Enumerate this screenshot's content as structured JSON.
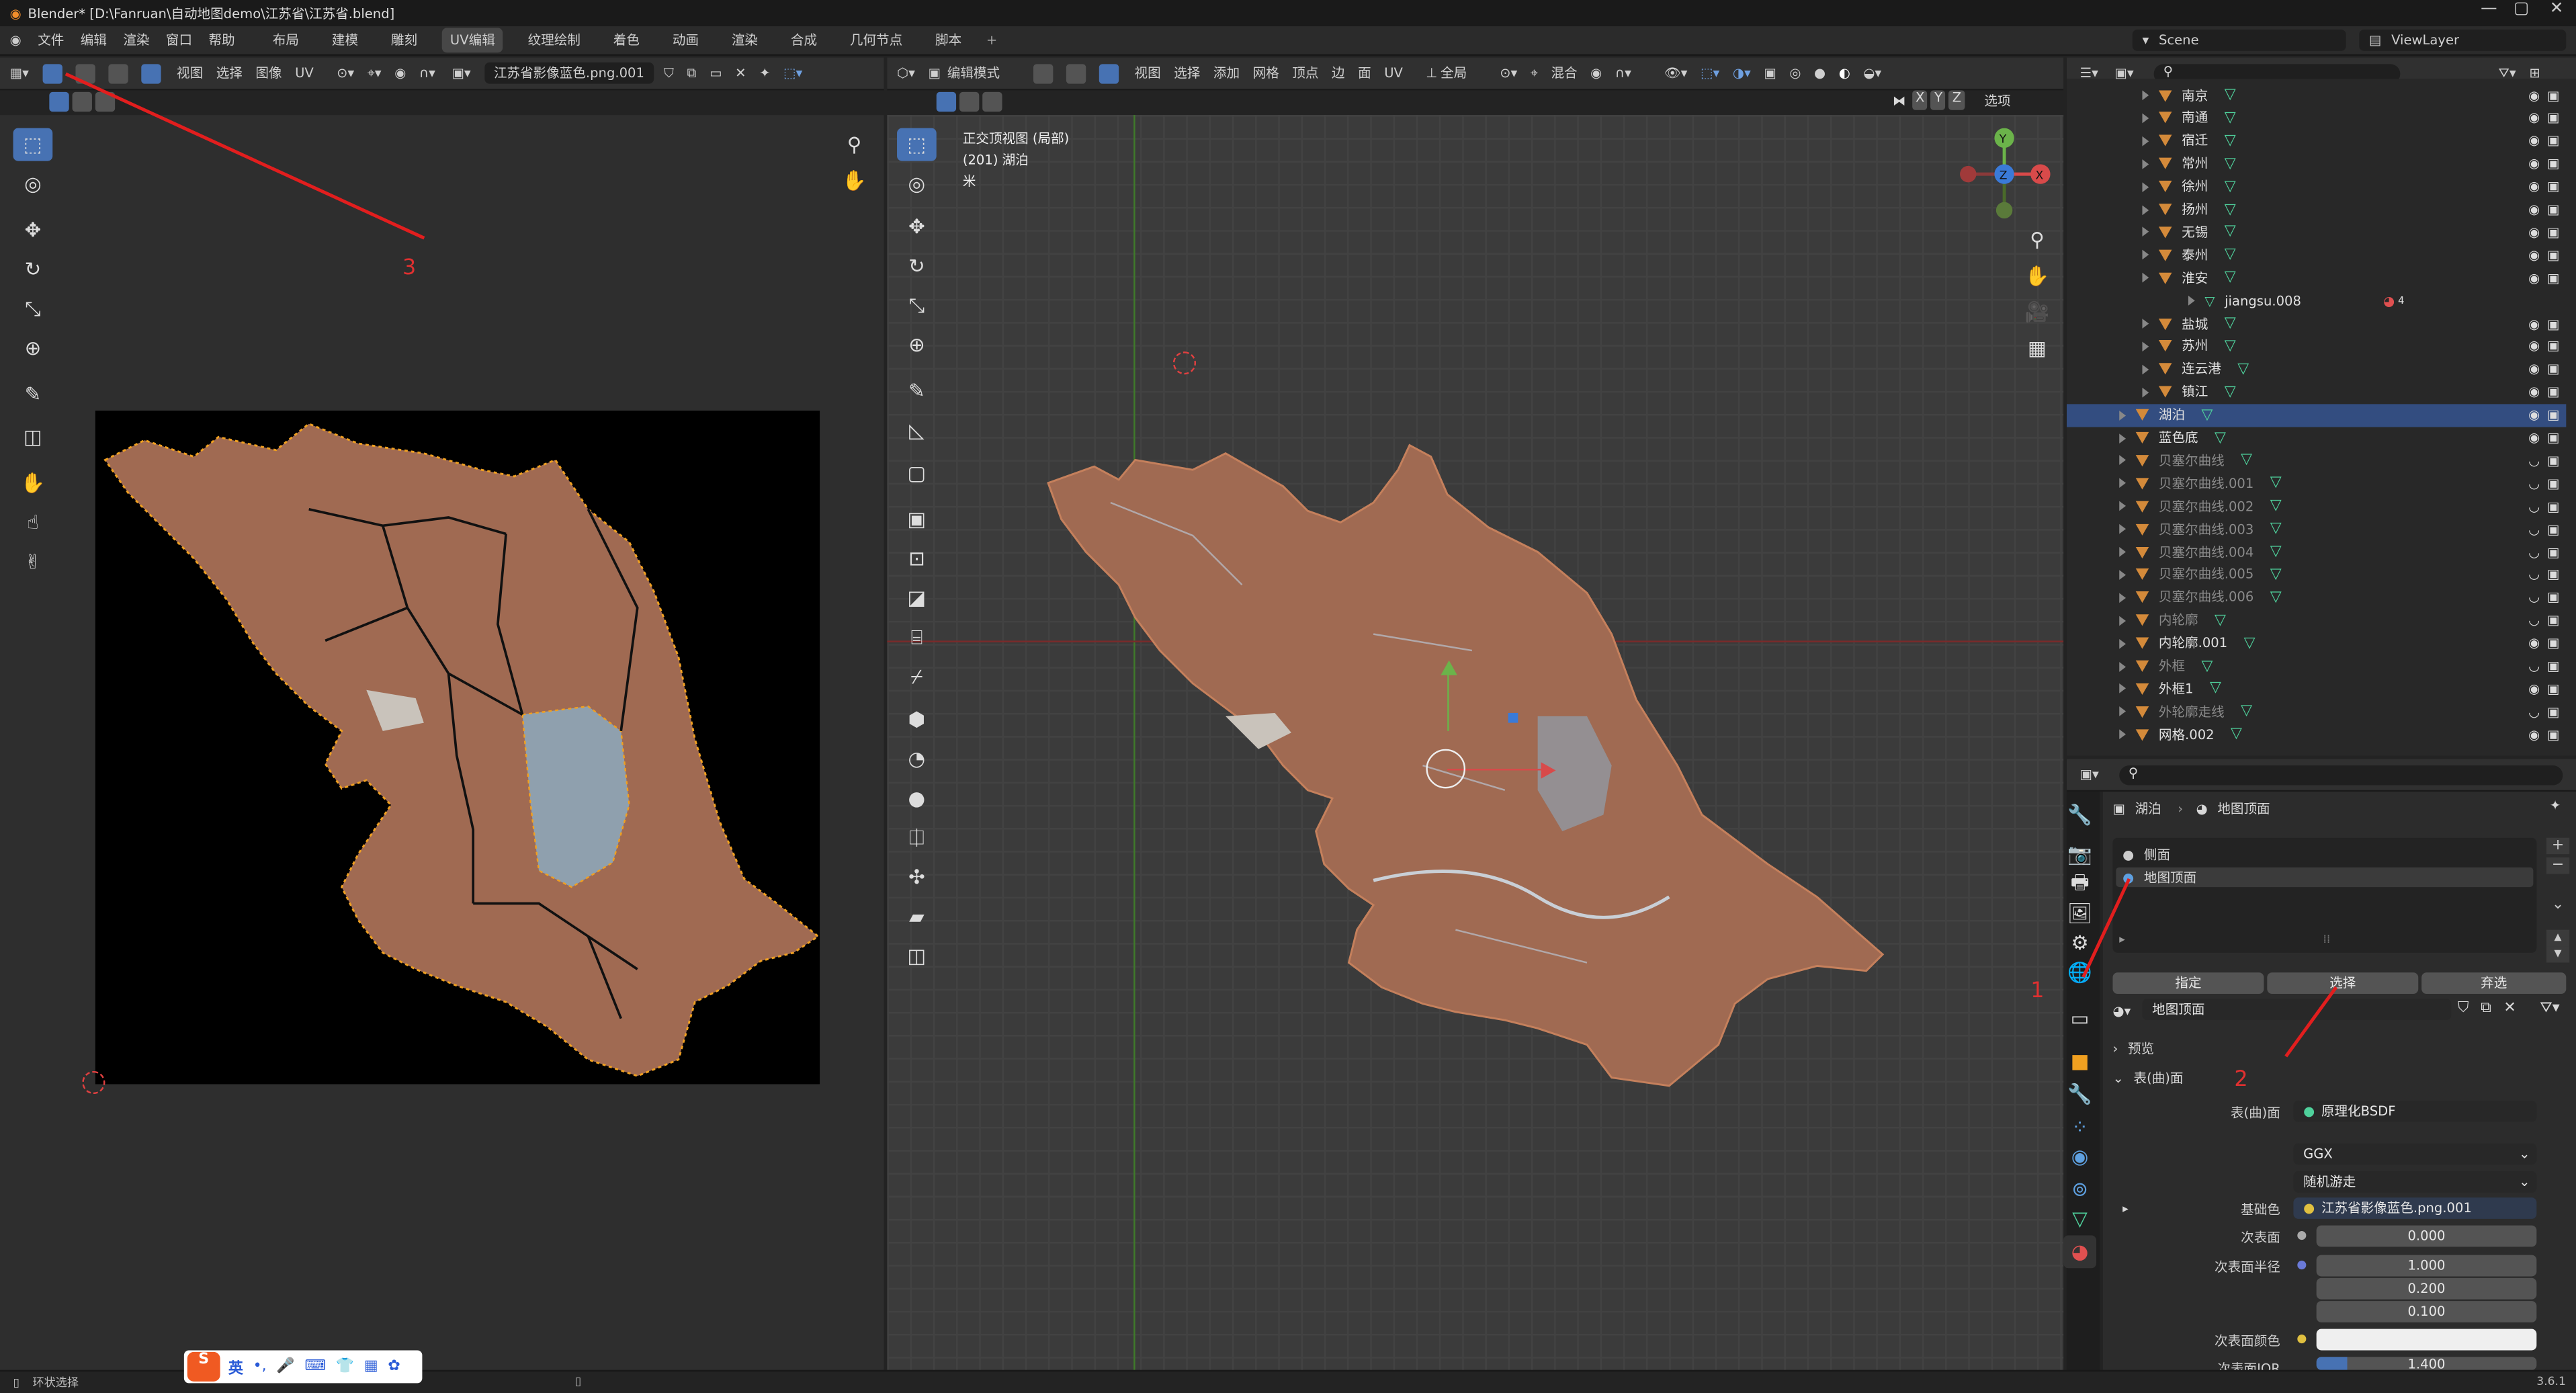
{
  "window": {
    "title": "Blender* [D:\\Fanruan\\自动地图demo\\江苏省\\江苏省.blend]"
  },
  "top_menu": {
    "items": [
      "文件",
      "编辑",
      "渲染",
      "窗口",
      "帮助"
    ],
    "workspaces": [
      "布局",
      "建模",
      "雕刻",
      "UV编辑",
      "纹理绘制",
      "着色",
      "动画",
      "渲染",
      "合成",
      "几何节点",
      "脚本"
    ],
    "active_workspace": "UV编辑",
    "scene": "Scene",
    "view_layer": "ViewLayer"
  },
  "uv_editor": {
    "menus": [
      "视图",
      "选择",
      "图像",
      "UV"
    ],
    "image_name": "江苏省影像蓝色.png.001"
  },
  "viewport": {
    "mode": "编辑模式",
    "menus": [
      "视图",
      "选择",
      "添加",
      "网格",
      "顶点",
      "边",
      "面",
      "UV"
    ],
    "transform_orientation": "全局",
    "blend": "混合",
    "axes": [
      "X",
      "Y",
      "Z"
    ],
    "options": "选项",
    "overlay_title": "正交顶视图 (局部)",
    "overlay_object": "(201) 湖泊",
    "overlay_unit": "米"
  },
  "outliner": {
    "rows": [
      {
        "label": "南京",
        "state": "normal"
      },
      {
        "label": "南通",
        "state": "normal"
      },
      {
        "label": "宿迁",
        "state": "normal"
      },
      {
        "label": "常州",
        "state": "normal"
      },
      {
        "label": "徐州",
        "state": "normal"
      },
      {
        "label": "扬州",
        "state": "normal"
      },
      {
        "label": "无锡",
        "state": "normal"
      },
      {
        "label": "泰州",
        "state": "normal"
      },
      {
        "label": "淮安",
        "state": "normal"
      },
      {
        "label": "jiangsu.008",
        "state": "child"
      },
      {
        "label": "盐城",
        "state": "normal"
      },
      {
        "label": "苏州",
        "state": "normal"
      },
      {
        "label": "连云港",
        "state": "normal"
      },
      {
        "label": "镇江",
        "state": "normal"
      },
      {
        "label": "湖泊",
        "state": "selected"
      },
      {
        "label": "蓝色底",
        "state": "normal"
      },
      {
        "label": "贝塞尔曲线",
        "state": "dim"
      },
      {
        "label": "贝塞尔曲线.001",
        "state": "dim"
      },
      {
        "label": "贝塞尔曲线.002",
        "state": "dim"
      },
      {
        "label": "贝塞尔曲线.003",
        "state": "dim"
      },
      {
        "label": "贝塞尔曲线.004",
        "state": "dim"
      },
      {
        "label": "贝塞尔曲线.005",
        "state": "dim"
      },
      {
        "label": "贝塞尔曲线.006",
        "state": "dim"
      },
      {
        "label": "内轮廓",
        "state": "dim"
      },
      {
        "label": "内轮廓.001",
        "state": "normal"
      },
      {
        "label": "外框",
        "state": "dim"
      },
      {
        "label": "外框1",
        "state": "normal"
      },
      {
        "label": "外轮廓走线",
        "state": "dim"
      },
      {
        "label": "网格.002",
        "state": "normal"
      }
    ],
    "child_badge": "4"
  },
  "properties": {
    "breadcrumb_object": "湖泊",
    "breadcrumb_material": "地图顶面",
    "material_slots": [
      "侧面",
      "地图顶面"
    ],
    "actions": [
      "指定",
      "选择",
      "弃选"
    ],
    "material_name": "地图顶面",
    "panels": {
      "preview": "预览",
      "surface": "表(曲)面"
    },
    "surface_label": "表(曲)面",
    "surface_value": "原理化BSDF",
    "distribution": "GGX",
    "subsurface_method": "随机游走",
    "base_color_label": "基础色",
    "base_color_value": "江苏省影像蓝色.png.001",
    "subsurface_label": "次表面",
    "subsurface_value": "0.000",
    "subsurface_radius_label": "次表面半径",
    "subsurface_radius": [
      "1.000",
      "0.200",
      "0.100"
    ],
    "subsurface_color_label": "次表面颜色",
    "subsurface_ior_label": "次表面IOR",
    "subsurface_ior_value": "1.400"
  },
  "statusbar": {
    "left": "环状选择",
    "version": "3.6.1",
    "ime": "英"
  },
  "annotations": [
    "1",
    "2",
    "3"
  ],
  "colors": {
    "accent": "#4772b3",
    "map_fill": "#a06a52",
    "uv_edge": "#f0a020",
    "annotation": "#e21e1e"
  }
}
